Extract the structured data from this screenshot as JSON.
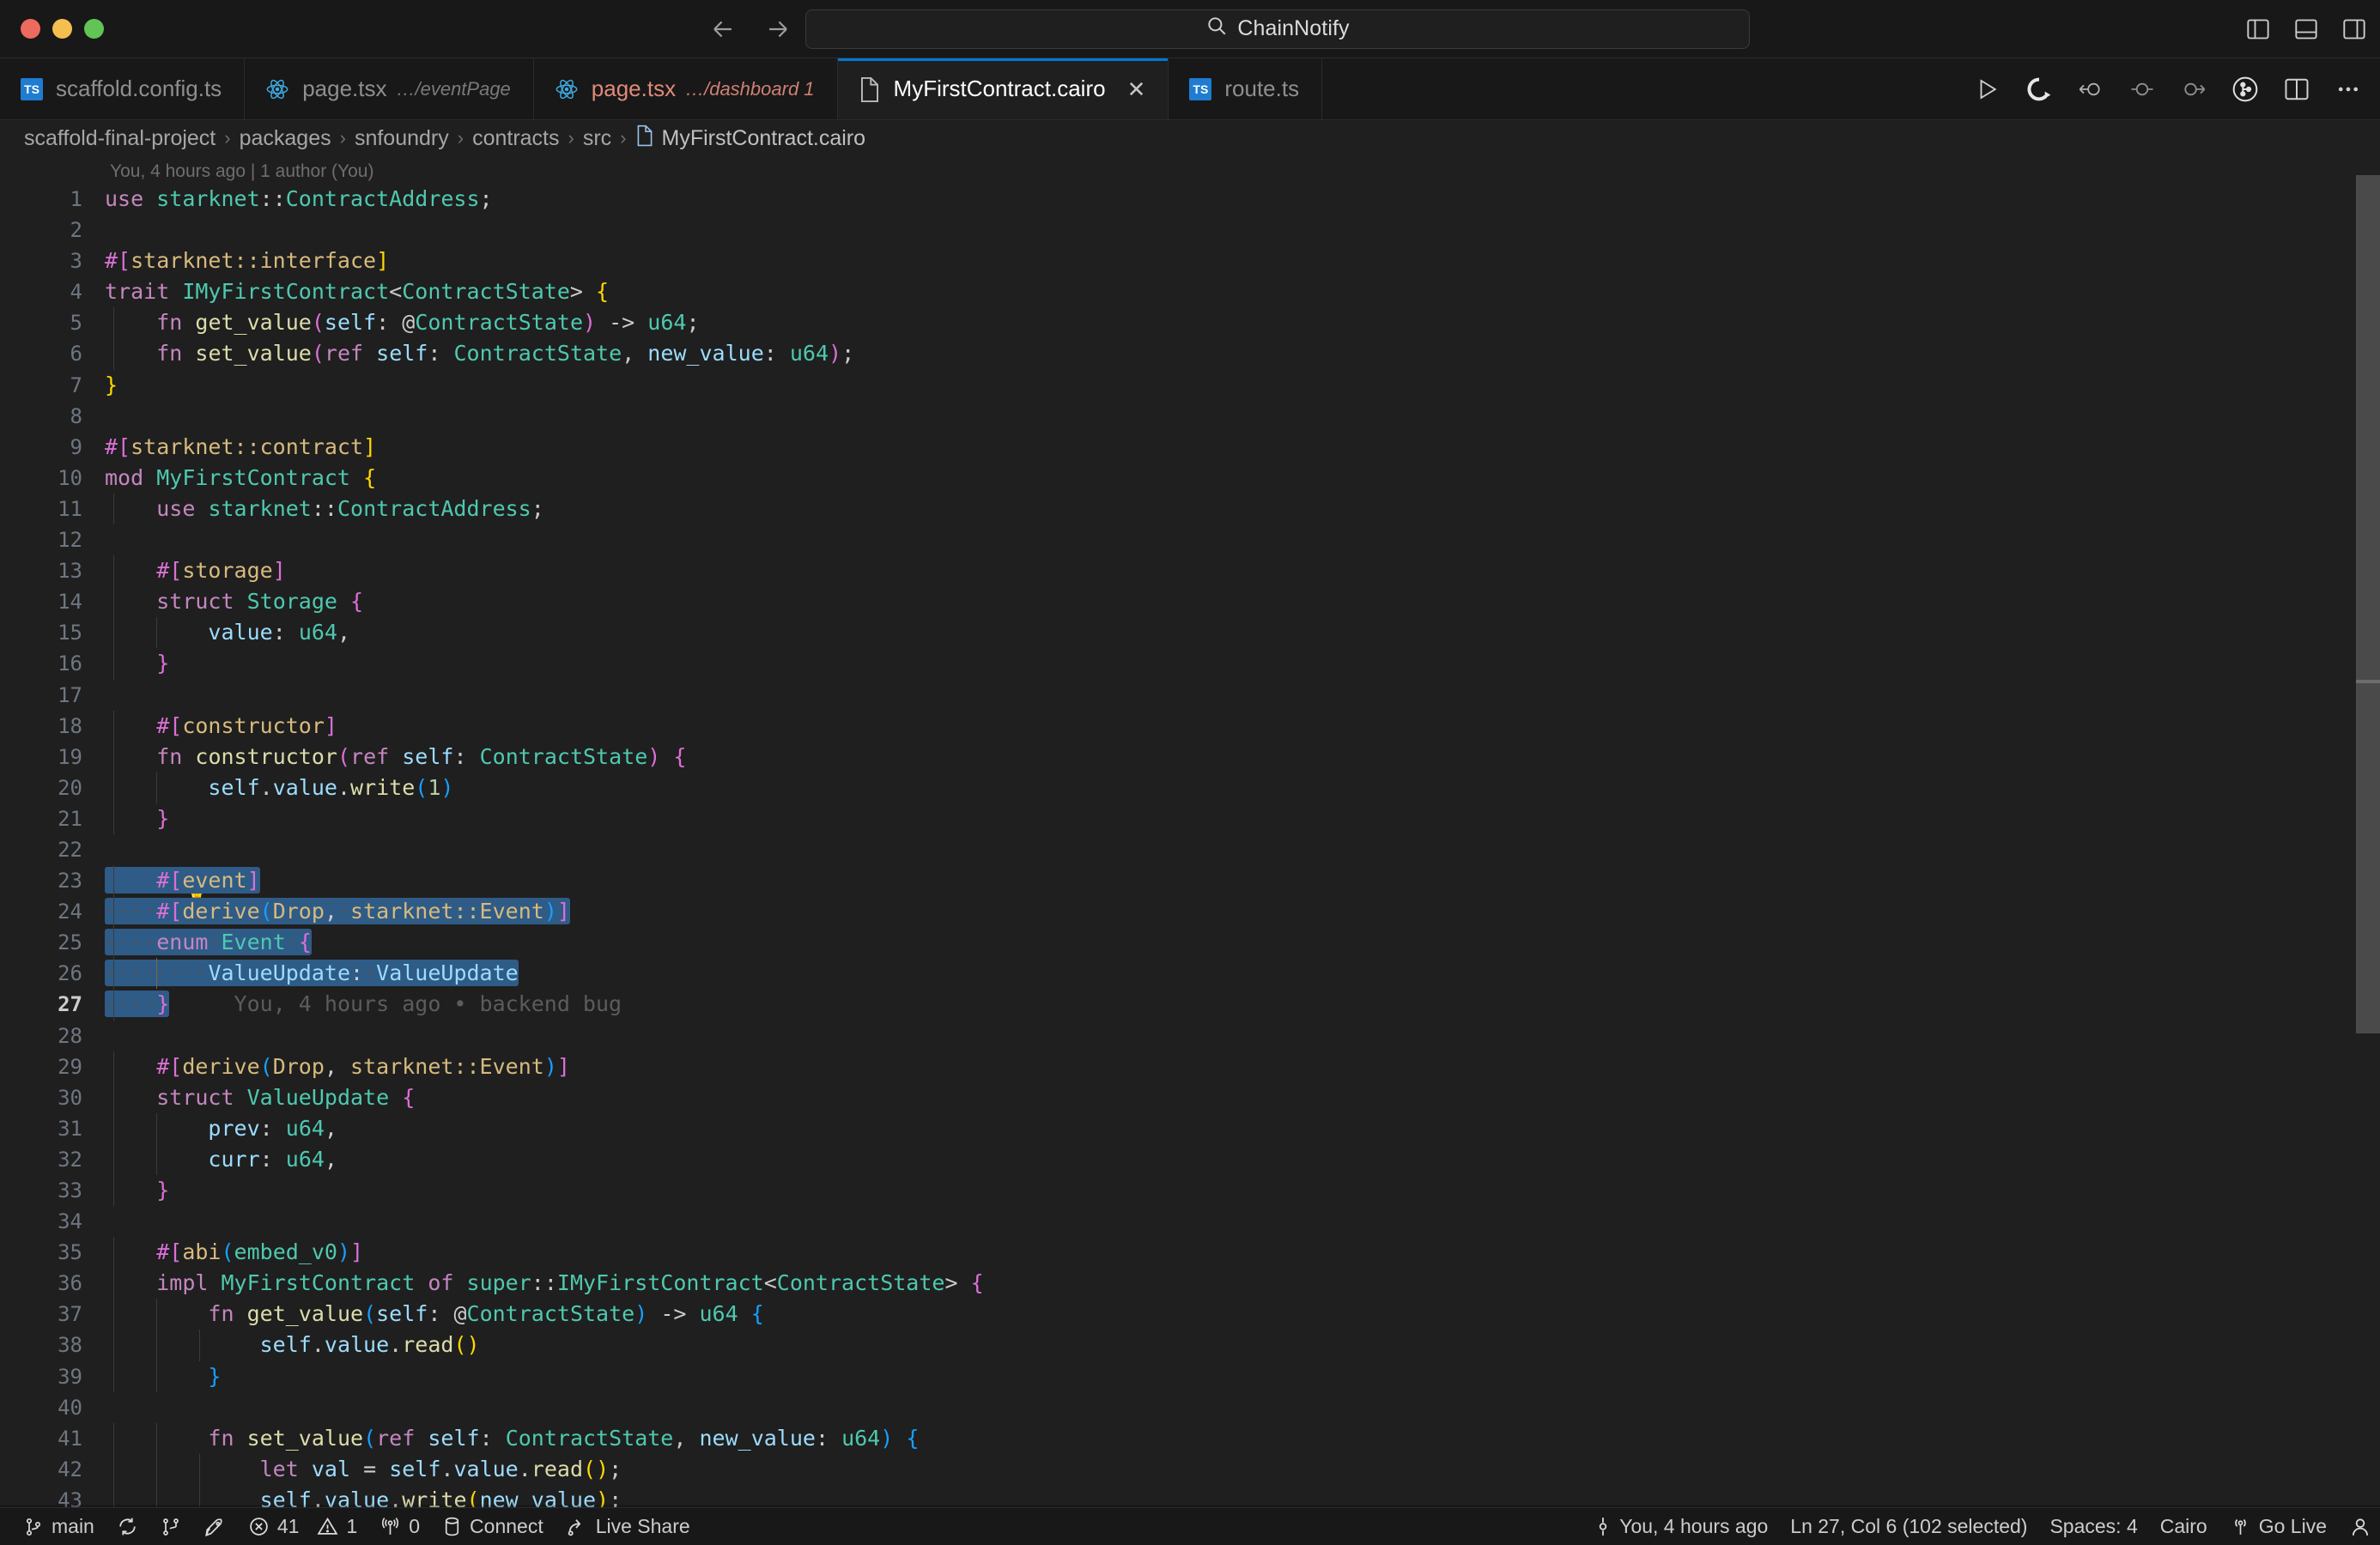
{
  "titlebar": {
    "traffic": [
      "close",
      "minimize",
      "maximize"
    ],
    "back_label": "Back",
    "forward_label": "Forward",
    "command_center_text": "ChainNotify",
    "layout_icons": [
      "layout-panel-left-icon",
      "layout-panel-bottom-icon",
      "layout-panel-right-icon"
    ]
  },
  "tabs": [
    {
      "label": "scaffold.config.ts",
      "desc": "",
      "icon": "typescript-icon",
      "active": false,
      "dirty": false,
      "close": ""
    },
    {
      "label": "page.tsx",
      "desc": "…/eventPage",
      "icon": "react-icon",
      "active": false,
      "dirty": false,
      "close": ""
    },
    {
      "label": "page.tsx",
      "desc": "…/dashboard 1",
      "icon": "react-icon",
      "active": false,
      "dirty": true,
      "close": ""
    },
    {
      "label": "MyFirstContract.cairo",
      "desc": "",
      "icon": "file-icon",
      "active": true,
      "dirty": false,
      "close": "✕"
    },
    {
      "label": "route.ts",
      "desc": "",
      "icon": "typescript-icon",
      "active": false,
      "dirty": false,
      "close": ""
    }
  ],
  "editor_actions": [
    "run-icon",
    "cairo-run-icon",
    "step-back-icon",
    "step-into-icon",
    "step-over-icon",
    "debug-alt-icon",
    "split-editor-icon",
    "more-actions-icon"
  ],
  "breadcrumb": {
    "items": [
      "scaffold-final-project",
      "packages",
      "snfoundry",
      "contracts",
      "src"
    ],
    "separator": "›",
    "file": "MyFirstContract.cairo"
  },
  "blame": {
    "header": "You, 4 hours ago | 1 author (You)",
    "inline": "You, 4 hours ago • backend bug"
  },
  "code": {
    "language": "Cairo",
    "first_line": 1,
    "last_line": 43,
    "cursor_line": 27,
    "lines": [
      "use starknet::ContractAddress;",
      "",
      "#[starknet::interface]",
      "trait IMyFirstContract<ContractState> {",
      "    fn get_value(self: @ContractState) -> u64;",
      "    fn set_value(ref self: ContractState, new_value: u64);",
      "}",
      "",
      "#[starknet::contract]",
      "mod MyFirstContract {",
      "    use starknet::ContractAddress;",
      "",
      "    #[storage]",
      "    struct Storage {",
      "        value: u64,",
      "    }",
      "",
      "    #[constructor]",
      "    fn constructor(ref self: ContractState) {",
      "        self.value.write(1)",
      "    }",
      "",
      "    #[event]",
      "    #[derive(Drop, starknet::Event)]",
      "    enum Event {",
      "        ValueUpdate: ValueUpdate",
      "    }",
      "",
      "    #[derive(Drop, starknet::Event)]",
      "    struct ValueUpdate {",
      "        prev: u64,",
      "        curr: u64,",
      "    }",
      "",
      "    #[abi(embed_v0)]",
      "    impl MyFirstContract of super::IMyFirstContract<ContractState> {",
      "        fn get_value(self: @ContractState) -> u64 {",
      "            self.value.read()",
      "        }",
      "",
      "        fn set_value(ref self: ContractState, new_value: u64) {",
      "            let val = self.value.read();",
      "            self.value.write(new_value);"
    ]
  },
  "statusbar": {
    "left": [
      {
        "name": "branch",
        "icon": "source-control-icon",
        "label": "main"
      },
      {
        "name": "sync",
        "icon": "sync-icon",
        "label": ""
      },
      {
        "name": "graph",
        "icon": "git-graph-icon",
        "label": ""
      },
      {
        "name": "rocket",
        "icon": "rocket-icon",
        "label": ""
      },
      {
        "name": "errors",
        "icon": "error-icon",
        "label": "41"
      },
      {
        "name": "warnings",
        "icon": "warning-icon",
        "label": "1"
      },
      {
        "name": "ports",
        "icon": "radio-tower-icon",
        "label": "0"
      },
      {
        "name": "connect",
        "icon": "database-icon",
        "label": "Connect"
      },
      {
        "name": "live-share",
        "icon": "live-share-icon",
        "label": "Live Share"
      }
    ],
    "right": [
      {
        "name": "git-blame",
        "icon": "git-commit-icon",
        "label": "You, 4 hours ago"
      },
      {
        "name": "cursor-position",
        "icon": "",
        "label": "Ln 27, Col 6 (102 selected)"
      },
      {
        "name": "indentation",
        "icon": "",
        "label": "Spaces: 4"
      },
      {
        "name": "language-mode",
        "icon": "",
        "label": "Cairo"
      },
      {
        "name": "go-live",
        "icon": "broadcast-icon",
        "label": "Go Live"
      },
      {
        "name": "accounts",
        "icon": "account-icon",
        "label": ""
      }
    ]
  },
  "colors": {
    "accent": "#0078d4",
    "editor_bg": "#1f1f1f",
    "chrome_bg": "#181818",
    "selection": "#2f5b87",
    "dirty_tab": "#e08a7a",
    "keyword": "#c586c0",
    "type": "#4ec9b0",
    "function": "#dcdcaa",
    "variable": "#9cdcfe",
    "attribute": "#d7ba7d",
    "number": "#b5cea8"
  }
}
